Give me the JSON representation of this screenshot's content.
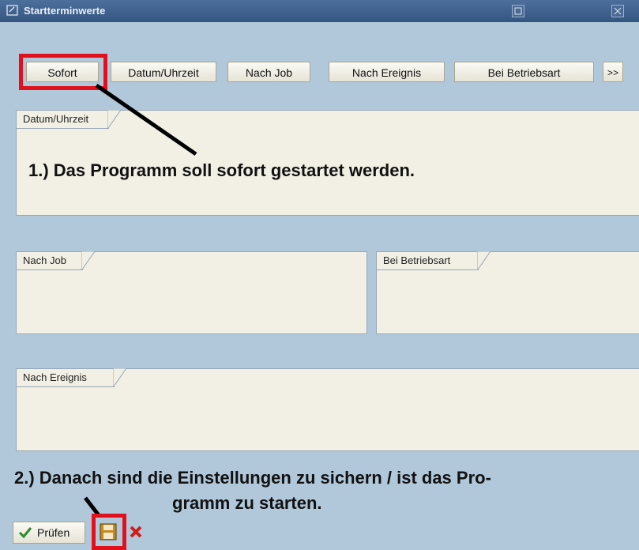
{
  "window": {
    "title": "Startterminwerte"
  },
  "buttons": {
    "sofort": "Sofort",
    "datum_uhrzeit": "Datum/Uhrzeit",
    "nach_job": "Nach Job",
    "nach_ereignis": "Nach Ereignis",
    "bei_betriebsart": "Bei Betriebsart",
    "more": ">>"
  },
  "groups": {
    "datum_uhrzeit": "Datum/Uhrzeit",
    "nach_job": "Nach Job",
    "bei_betriebsart": "Bei Betriebsart",
    "nach_ereignis": "Nach Ereignis"
  },
  "annotations": {
    "step1": "1.) Das Programm soll sofort gestartet werden.",
    "step2_line1": "2.) Danach sind die Einstellungen zu sichern / ist das Pro-",
    "step2_line2": "gramm zu starten."
  },
  "bottom": {
    "pruefen": "Prüfen",
    "save_icon": "save-icon",
    "cancel_icon": "cancel-icon"
  },
  "colors": {
    "background": "#b1c8db",
    "highlight": "#e2101c",
    "panel": "#f2f0e4"
  }
}
